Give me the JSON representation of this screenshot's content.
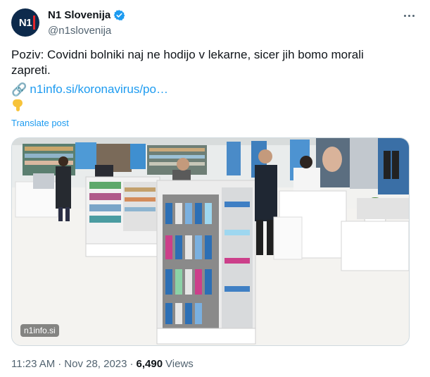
{
  "author": {
    "display_name": "N1 Slovenija",
    "handle": "@n1slovenija",
    "avatar_text": "N1"
  },
  "tweet": {
    "text": "Poziv: Covidni bolniki naj ne hodijo v lekarne, sicer jih bomo morali zapreti.",
    "link_text": "n1info.si/koronavirus/po…",
    "link_icon": "🔗",
    "translate_label": "Translate post",
    "image_watermark": "n1info.si",
    "time": "11:23 AM",
    "date": "Nov 28, 2023",
    "views_count": "6,490",
    "views_label": "Views",
    "separator": "·"
  },
  "colors": {
    "link": "#1d9bf0",
    "secondary_text": "#536471",
    "verified": "#1d9bf0",
    "avatar_bg": "#0d2a4c"
  },
  "icons": [
    "verified-badge-icon",
    "more-options-icon",
    "link-icon",
    "pointing-down-emoji-icon"
  ]
}
